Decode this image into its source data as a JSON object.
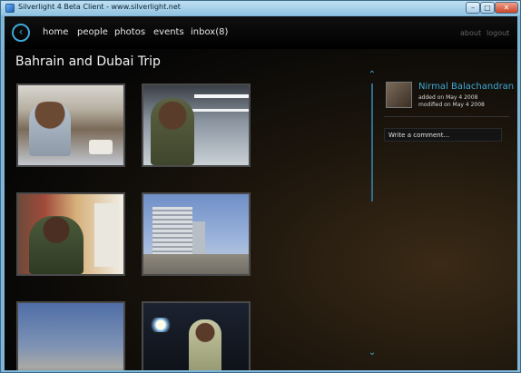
{
  "window": {
    "title": "Silverlight 4 Beta Client - www.silverlight.net",
    "min_glyph": "–",
    "max_glyph": "□",
    "close_glyph": "✕"
  },
  "nav": {
    "back_glyph": "‹",
    "items": [
      "home",
      "people",
      "photos",
      "events",
      "inbox(8)"
    ],
    "right_items": [
      "about",
      "logout"
    ]
  },
  "album": {
    "title": "Bahrain and Dubai Trip"
  },
  "photos": [
    {
      "name": "photo-man-restaurant",
      "icon": "photo-restaurant"
    },
    {
      "name": "photo-man-airport",
      "icon": "photo-airport"
    },
    {
      "name": "photo-man-bookstore",
      "icon": "photo-bookstore"
    },
    {
      "name": "photo-hotel-tower",
      "icon": "photo-building"
    },
    {
      "name": "photo-dusk-horizon",
      "icon": "photo-horizon"
    },
    {
      "name": "photo-man-night-lights",
      "icon": "photo-night"
    }
  ],
  "scroll": {
    "up_glyph": "⌃",
    "down_glyph": "⌄"
  },
  "details": {
    "owner": "Nirmal Balachandran",
    "added": "added on May 4 2008",
    "modified": "modified on May 4 2008",
    "comment_placeholder": "Write a comment..."
  },
  "colors": {
    "accent": "#3fa8d6",
    "background": "#060606"
  }
}
